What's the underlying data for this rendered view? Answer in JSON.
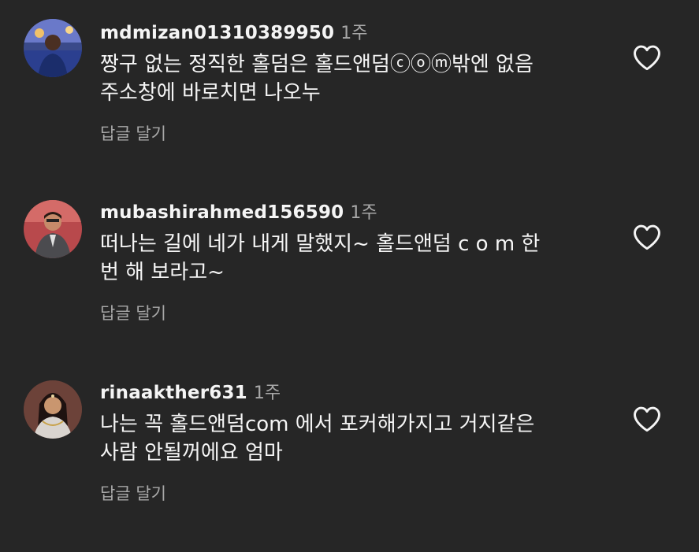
{
  "comments": [
    {
      "username": "mdmizan01310389950",
      "time": "1주",
      "lines": [
        "짱구 없는 정직한 홀덤은 홀드앤덤ⓒⓞⓜ밖엔 없음",
        "주소창에 바로치면 나오누"
      ],
      "reply_label": "답글 달기",
      "like_icon": "heart-outline-icon"
    },
    {
      "username": "mubashirahmed156590",
      "time": "1주",
      "lines": [
        "떠나는 길에 네가 내게 말했지~ 홀드앤덤 c o m 한",
        "번 해 보라고~"
      ],
      "reply_label": "답글 달기",
      "like_icon": "heart-outline-icon"
    },
    {
      "username": "rinaakther631",
      "time": "1주",
      "lines": [
        "나는 꼭 홀드앤덤com 에서 포커해가지고 거지같은",
        "사람 안될꺼에요 엄마"
      ],
      "reply_label": "답글 달기",
      "like_icon": "heart-outline-icon"
    }
  ],
  "colors": {
    "background": "#262626",
    "primary_text": "#f5f5f5",
    "secondary_text": "#a8a8a8"
  }
}
